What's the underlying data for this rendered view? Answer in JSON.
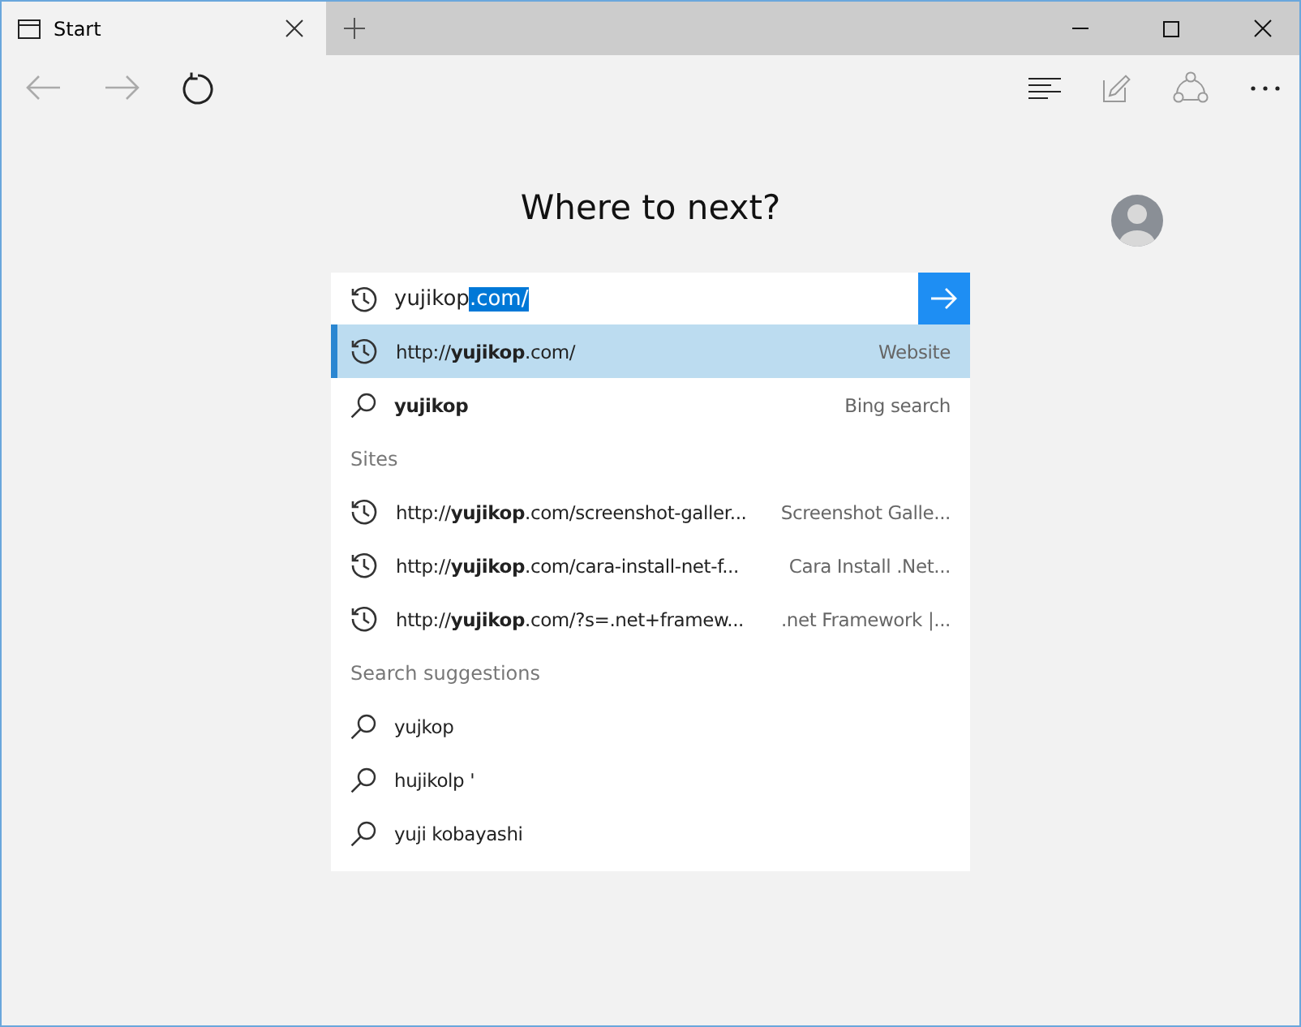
{
  "tab": {
    "title": "Start",
    "selected": true
  },
  "heading": "Where to next?",
  "address": {
    "typed": "yujikop",
    "selected_text": ".com/"
  },
  "suggestions": [
    {
      "kind": "history",
      "text": "http://**yujikop**.com/",
      "hint": "Website",
      "selected": true
    },
    {
      "kind": "search",
      "text": "**yujikop**",
      "hint": "Bing search",
      "selected": false
    },
    {
      "kind": "header",
      "text": "Sites"
    },
    {
      "kind": "history",
      "text": "http://**yujikop**.com/screenshot-galler...",
      "hint": "Screenshot Galle...",
      "selected": false
    },
    {
      "kind": "history",
      "text": "http://**yujikop**.com/cara-install-net-f...",
      "hint": "Cara Install .Net...",
      "selected": false
    },
    {
      "kind": "history",
      "text": "http://**yujikop**.com/?s=.net+framew...",
      "hint": ".net Framework |...",
      "selected": false
    },
    {
      "kind": "header",
      "text": "Search suggestions"
    },
    {
      "kind": "search",
      "text": "yujkop",
      "selected": false
    },
    {
      "kind": "search",
      "text": "hujikolp '",
      "selected": false
    },
    {
      "kind": "search",
      "text": "yuji kobayashi",
      "selected": false
    }
  ]
}
